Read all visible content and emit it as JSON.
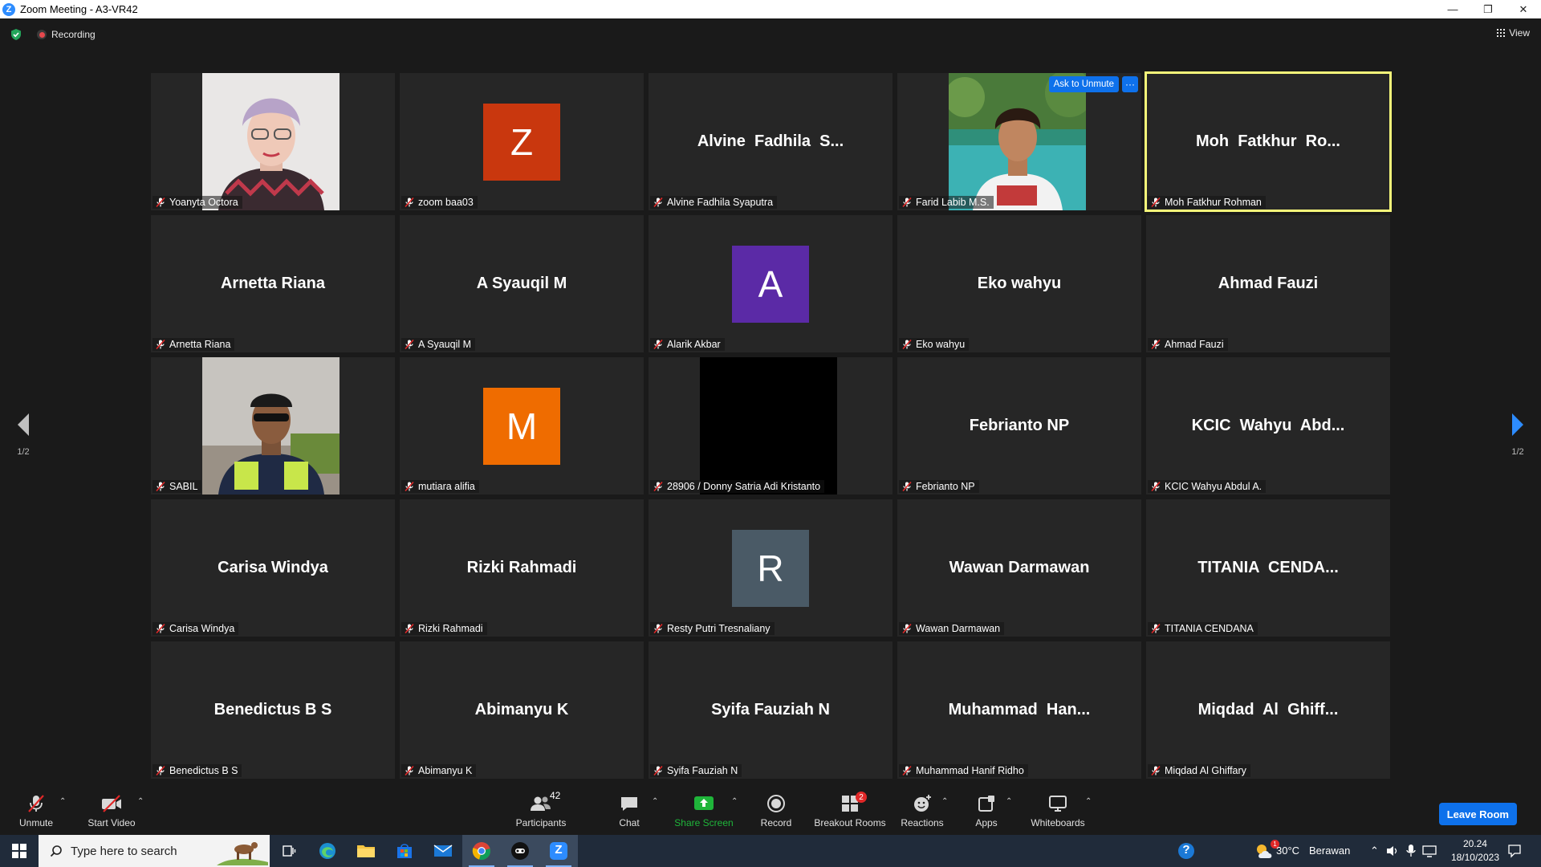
{
  "window": {
    "app_logo_letter": "Z",
    "title": "Zoom Meeting - A3-VR42",
    "controls": {
      "minimize": "—",
      "restore": "❐",
      "close": "✕"
    }
  },
  "top": {
    "recording_label": "Recording",
    "view_label": "View"
  },
  "pager": {
    "left_label": "1/2",
    "right_label": "1/2"
  },
  "participants": [
    {
      "display": "photo",
      "name": "Yoanyta Octora"
    },
    {
      "display": "avatar",
      "letter": "Z",
      "color": "#c9370e",
      "name": "zoom baa03"
    },
    {
      "display": "text",
      "big": "Alvine  Fadhila  S...",
      "name": "Alvine Fadhila Syaputra"
    },
    {
      "display": "photo",
      "name": "Farid Labib M.S.",
      "ask_label": "Ask to Unmute",
      "more_label": "···"
    },
    {
      "display": "text",
      "big": "Moh  Fatkhur  Ro...",
      "name": "Moh Fatkhur Rohman",
      "active": true
    },
    {
      "display": "text",
      "big": "Arnetta Riana",
      "name": "Arnetta Riana"
    },
    {
      "display": "text",
      "big": "A Syauqil M",
      "name": "A Syauqil M"
    },
    {
      "display": "avatar",
      "letter": "A",
      "color": "#5b2aa6",
      "name": "Alarik Akbar"
    },
    {
      "display": "text",
      "big": "Eko wahyu",
      "name": "Eko wahyu"
    },
    {
      "display": "text",
      "big": "Ahmad Fauzi",
      "name": "Ahmad Fauzi"
    },
    {
      "display": "photo",
      "name": "SABIL"
    },
    {
      "display": "avatar",
      "letter": "M",
      "color": "#ef6c00",
      "name": "mutiara alifia"
    },
    {
      "display": "black",
      "name": "28906 / Donny Satria Adi Kristanto"
    },
    {
      "display": "text",
      "big": "Febrianto NP",
      "name": "Febrianto NP"
    },
    {
      "display": "text",
      "big": "KCIC  Wahyu  Abd...",
      "name": "KCIC Wahyu Abdul A."
    },
    {
      "display": "text",
      "big": "Carisa Windya",
      "name": "Carisa Windya"
    },
    {
      "display": "text",
      "big": "Rizki Rahmadi",
      "name": "Rizki Rahmadi"
    },
    {
      "display": "avatar",
      "letter": "R",
      "color": "#4a5a66",
      "name": "Resty Putri Tresnaliany"
    },
    {
      "display": "text",
      "big": "Wawan Darmawan",
      "name": "Wawan Darmawan"
    },
    {
      "display": "text",
      "big": "TITANIA  CENDA...",
      "name": "TITANIA CENDANA"
    },
    {
      "display": "text",
      "big": "Benedictus B S",
      "name": "Benedictus B S"
    },
    {
      "display": "text",
      "big": "Abimanyu K",
      "name": "Abimanyu K"
    },
    {
      "display": "text",
      "big": "Syifa Fauziah N",
      "name": "Syifa Fauziah N"
    },
    {
      "display": "text",
      "big": "Muhammad  Han...",
      "name": "Muhammad Hanif Ridho"
    },
    {
      "display": "text",
      "big": "Miqdad  Al  Ghiff...",
      "name": "Miqdad Al Ghiffary"
    }
  ],
  "toolbar": {
    "unmute": "Unmute",
    "start_video": "Start Video",
    "participants": "Participants",
    "participants_count": "42",
    "chat": "Chat",
    "share_screen": "Share Screen",
    "record": "Record",
    "breakout_rooms": "Breakout Rooms",
    "breakout_badge": "2",
    "reactions": "Reactions",
    "apps": "Apps",
    "whiteboards": "Whiteboards",
    "leave_room": "Leave Room",
    "caret": "⌃"
  },
  "taskbar": {
    "search_placeholder": "Type here to search",
    "temperature": "30°C",
    "weather": "Berawan",
    "time": "20.24",
    "date": "18/10/2023",
    "weather_badge": "1",
    "tray_chevron": "⌃",
    "zoom_letter": "Z",
    "help_symbol": "?"
  },
  "colors": {
    "accent": "#0e71eb",
    "active_speaker": "#f7f97a",
    "share_green": "#1fb53a"
  }
}
